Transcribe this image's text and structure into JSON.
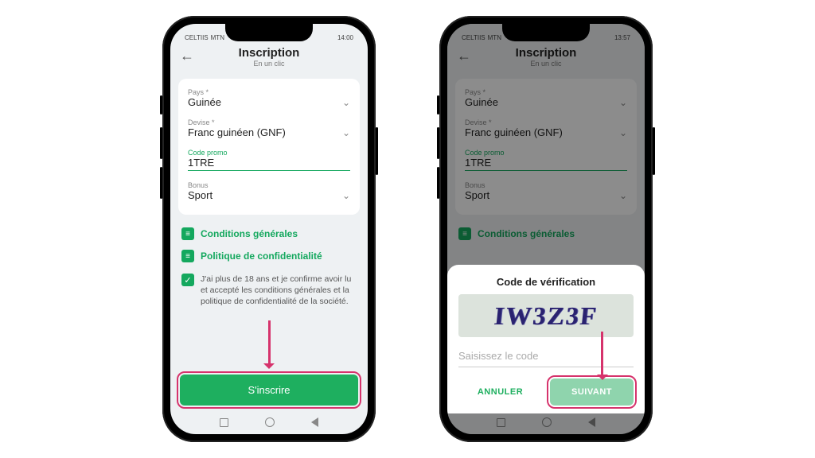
{
  "status": {
    "carrier1": "CELTIIS",
    "carrier2": "MTN",
    "time1": "14:00",
    "time2": "13:57",
    "batt_icon": "▮▮▯"
  },
  "header": {
    "title": "Inscription",
    "subtitle": "En un clic"
  },
  "fields": {
    "country_label": "Pays *",
    "country_value": "Guinée",
    "currency_label": "Devise *",
    "currency_value": "Franc guinéen (GNF)",
    "promo_label": "Code promo",
    "promo_value": "1TRE",
    "bonus_label": "Bonus",
    "bonus_value": "Sport"
  },
  "links": {
    "terms": "Conditions générales",
    "privacy": "Politique de confidentialité"
  },
  "consent": "J'ai plus de 18 ans et je confirme avoir lu et accepté les conditions générales et la politique de confidentialité de la société.",
  "primary_button": "S'inscrire",
  "modal": {
    "title": "Code de vérification",
    "captcha": "IW3Z3F",
    "placeholder": "Saisissez le code",
    "cancel": "ANNULER",
    "next": "SUIVANT"
  }
}
